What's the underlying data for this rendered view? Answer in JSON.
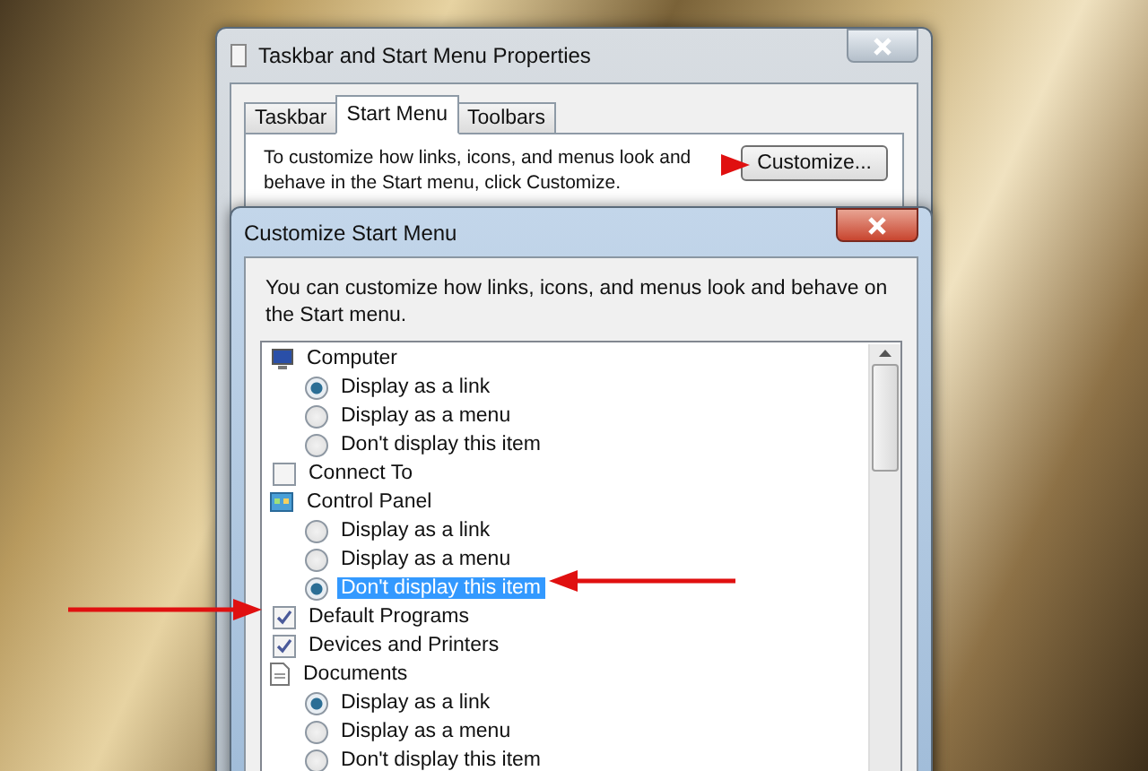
{
  "properties_window": {
    "title": "Taskbar and Start Menu Properties",
    "tabs": [
      {
        "label": "Taskbar",
        "selected": false
      },
      {
        "label": "Start Menu",
        "selected": true
      },
      {
        "label": "Toolbars",
        "selected": false
      }
    ],
    "description": "To customize how links, icons, and menus look and behave in the Start menu, click Customize.",
    "customize_button": "Customize..."
  },
  "customize_dialog": {
    "title": "Customize Start Menu",
    "description": "You can customize how links, icons, and menus look and behave on the Start menu.",
    "items": [
      {
        "kind": "group",
        "label": "Computer",
        "options": [
          {
            "label": "Display as a link",
            "selected": true,
            "highlighted": false
          },
          {
            "label": "Display as a menu",
            "selected": false,
            "highlighted": false
          },
          {
            "label": "Don't display this item",
            "selected": false,
            "highlighted": false
          }
        ]
      },
      {
        "kind": "check",
        "label": "Connect To",
        "checked": false
      },
      {
        "kind": "group",
        "label": "Control Panel",
        "options": [
          {
            "label": "Display as a link",
            "selected": false,
            "highlighted": false
          },
          {
            "label": "Display as a menu",
            "selected": false,
            "highlighted": false
          },
          {
            "label": "Don't display this item",
            "selected": true,
            "highlighted": true
          }
        ]
      },
      {
        "kind": "check",
        "label": "Default Programs",
        "checked": true
      },
      {
        "kind": "check",
        "label": "Devices and Printers",
        "checked": true
      },
      {
        "kind": "group",
        "label": "Documents",
        "options": [
          {
            "label": "Display as a link",
            "selected": true,
            "highlighted": false
          },
          {
            "label": "Display as a menu",
            "selected": false,
            "highlighted": false
          },
          {
            "label": "Don't display this item",
            "selected": false,
            "highlighted": false
          }
        ]
      }
    ]
  }
}
